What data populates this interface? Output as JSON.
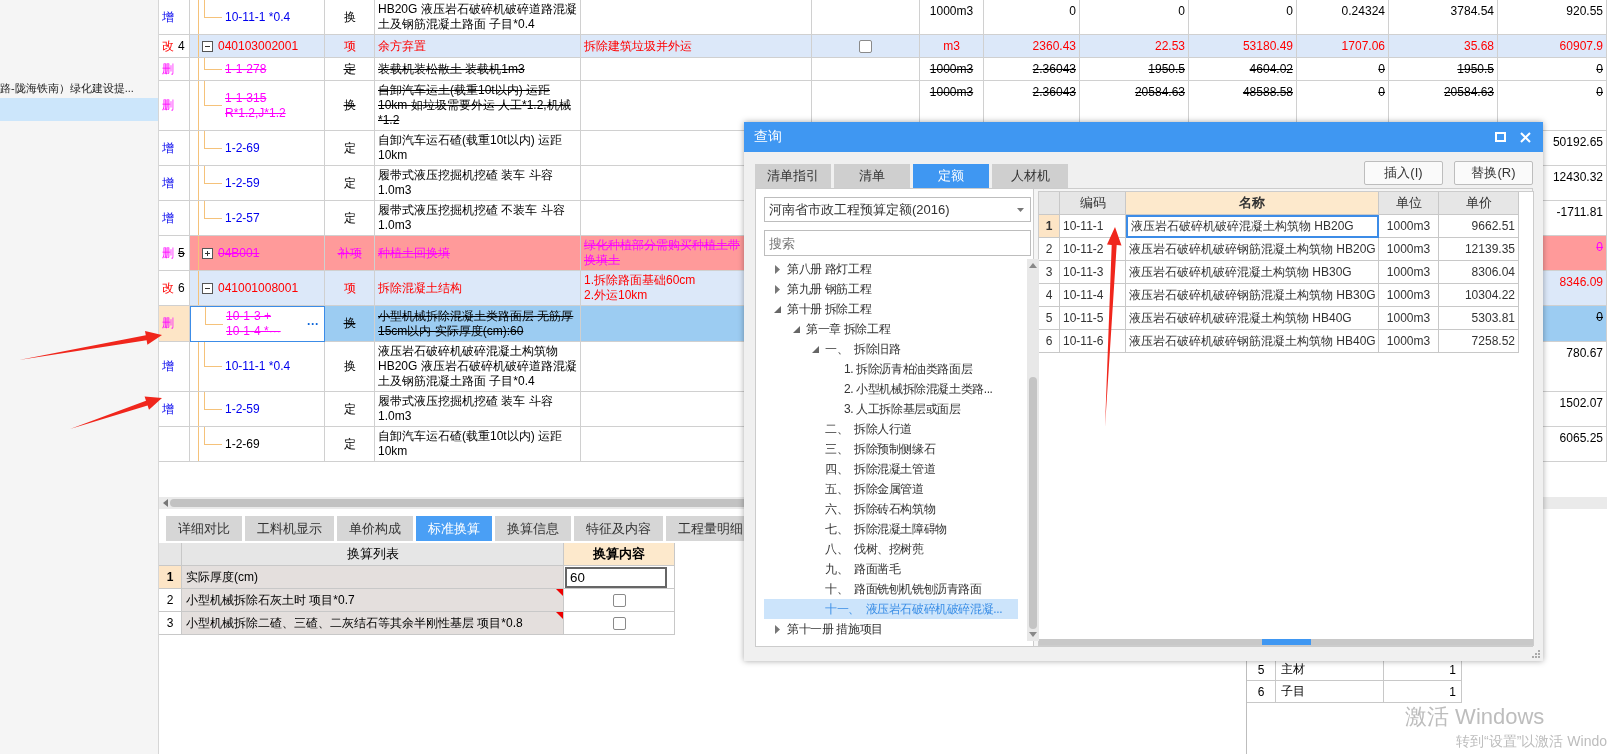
{
  "sidebar": {
    "label": "路-陇海铁南）绿化建设提..."
  },
  "main_grid": {
    "rows": [
      {
        "mark": {
          "label": "增",
          "kind": "added"
        },
        "kind": "sub",
        "code": "10-11-1 *0.4",
        "type": "换",
        "name": "HB20G  液压岩石破碎机破碎道路混凝土及钢筋混凝土路面 子目*0.4",
        "unit": "1000m3",
        "values": [
          "0",
          "0",
          "0",
          "0.24324",
          "3784.54",
          "920.55"
        ],
        "selected": false
      },
      {
        "mark": {
          "label": "改",
          "kind": "modified"
        },
        "number": "4",
        "kind": "item",
        "expanded": true,
        "code": "040103002001",
        "type": "项",
        "name": "余方弃置",
        "feature": "拆除建筑垃圾并外运",
        "checked": false,
        "unit": "m3",
        "values": [
          "2360.43",
          "22.53",
          "53180.49",
          "1707.06",
          "35.68",
          "60907.9"
        ],
        "selected": false
      },
      {
        "mark": {
          "label": "删",
          "kind": "deleted"
        },
        "kind": "sub",
        "code": "1-1-278",
        "type": "定",
        "name": "装载机装松散土 装载机1m3",
        "unit": "1000m3",
        "values": [
          "2.36043",
          "1950.5",
          "4604.02",
          "0",
          "1950.5",
          "0"
        ],
        "selected": false
      },
      {
        "mark": {
          "label": "删",
          "kind": "deleted"
        },
        "kind": "sub",
        "code": "1-1-315\nR*1.2,J*1.2",
        "type": "换",
        "name": "自卸汽车运土(载重10t以内) 运距10km  如垃圾需要外运 人工*1.2,机械*1.2",
        "unit": "1000m3",
        "values": [
          "2.36043",
          "20584.63",
          "48588.58",
          "0",
          "20584.63",
          "0"
        ],
        "selected": false
      },
      {
        "mark": {
          "label": "增",
          "kind": "added"
        },
        "kind": "sub",
        "code": "1-2-69",
        "type": "定",
        "name": "自卸汽车运石碴(载重10t以内) 运距10km",
        "values": [
          "50192.65"
        ],
        "selected": false
      },
      {
        "mark": {
          "label": "增",
          "kind": "added"
        },
        "kind": "sub",
        "code": "1-2-59",
        "type": "定",
        "name": "履带式液压挖掘机挖碴 装车 斗容1.0m3",
        "values": [
          "12430.32"
        ],
        "selected": false
      },
      {
        "mark": {
          "label": "增",
          "kind": "added"
        },
        "kind": "sub",
        "code": "1-2-57",
        "type": "定",
        "name": "履带式液压挖掘机挖碴 不装车 斗容1.0m3",
        "values": [
          "-1711.81"
        ],
        "selected": false
      },
      {
        "mark": {
          "label": "删",
          "kind": "deleted"
        },
        "number": "5",
        "kind": "item",
        "expanded": false,
        "code": "04B001",
        "type": "补项",
        "name": "种植土回换填",
        "feature": "绿化种植部分需购买种植土带换填土",
        "values": [
          "0"
        ],
        "selected": false
      },
      {
        "mark": {
          "label": "改",
          "kind": "modified"
        },
        "number": "6",
        "kind": "item",
        "expanded": true,
        "code": "041001008001",
        "type": "项",
        "name": "拆除混凝土结构",
        "feature": "1.拆除路面基础60cm\n2.外运10km",
        "values": [
          "8346.09"
        ],
        "selected": false
      },
      {
        "mark": {
          "label": "删",
          "kind": "deleted"
        },
        "kind": "sub",
        "code": "10-1-3 +\n10-1-4 *···",
        "more": "···",
        "type": "换",
        "name": "小型机械拆除混凝土类路面层 无筋厚15cm以内  实际厚度(cm):60",
        "values": [
          "0"
        ],
        "selected": true
      },
      {
        "mark": {
          "label": "增",
          "kind": "added"
        },
        "kind": "sub",
        "code": "10-11-1 *0.4",
        "type": "换",
        "name": "液压岩石破碎机破碎混凝土构筑物HB20G  液压岩石破碎机破碎道路混凝土及钢筋混凝土路面 子目*0.4",
        "values": [
          "780.67"
        ],
        "selected": false
      },
      {
        "mark": {
          "label": "增",
          "kind": "added"
        },
        "kind": "sub",
        "code": "1-2-59",
        "type": "定",
        "name": "履带式液压挖掘机挖碴 装车 斗容1.0m3",
        "values": [
          "1502.07"
        ],
        "selected": false
      },
      {
        "kind": "sub",
        "code": "1-2-69",
        "type": "定",
        "name": "自卸汽车运石碴(载重10t以内) 运距10km",
        "values": [
          "6065.25"
        ],
        "selected": false
      }
    ]
  },
  "detail_tabs": [
    {
      "label": "详细对比",
      "selected": false
    },
    {
      "label": "工料机显示",
      "selected": false
    },
    {
      "label": "单价构成",
      "selected": false
    },
    {
      "label": "标准换算",
      "selected": true
    },
    {
      "label": "换算信息",
      "selected": false
    },
    {
      "label": "特征及内容",
      "selected": false
    },
    {
      "label": "工程量明细",
      "selected": false
    }
  ],
  "conversion_table": {
    "columns": [
      "换算列表",
      "换算内容"
    ],
    "rows": [
      {
        "number": "1",
        "label": "实际厚度(cm)",
        "kind": "input",
        "value": "60",
        "selected": true,
        "marked": false
      },
      {
        "number": "2",
        "label": "小型机械拆除石灰土时 项目*0.7",
        "kind": "checkbox",
        "checked": false,
        "selected": false,
        "marked": true
      },
      {
        "number": "3",
        "label": "小型机械拆除二碴、三碴、二灰结石等其余半刚性基层 项目*0.8",
        "kind": "checkbox",
        "checked": false,
        "selected": false,
        "marked": true
      }
    ]
  },
  "side_table": {
    "rows": [
      {
        "number": "5",
        "name": "主材",
        "value": "1"
      },
      {
        "number": "6",
        "name": "子目",
        "value": "1"
      }
    ]
  },
  "query_dialog": {
    "title": "查询",
    "tabs": [
      {
        "label": "清单指引",
        "selected": false
      },
      {
        "label": "清单",
        "selected": false
      },
      {
        "label": "定额",
        "selected": true
      },
      {
        "label": "人材机",
        "selected": false
      }
    ],
    "buttons": [
      "插入(I)",
      "替换(R)"
    ],
    "library": "河南省市政工程预算定额(2016)",
    "search": {
      "placeholder": "搜索"
    },
    "tree": [
      {
        "label": "第八册 路灯工程",
        "expanded": false,
        "selected": false
      },
      {
        "label": "第九册 钢筋工程",
        "expanded": false,
        "selected": false
      },
      {
        "label": "第十册 拆除工程",
        "expanded": true,
        "selected": false,
        "children": [
          {
            "label": "第一章 拆除工程",
            "expanded": true,
            "selected": false,
            "children": [
              {
                "label": "一、  拆除旧路",
                "expanded": true,
                "selected": false,
                "children": [
                  {
                    "label": "1. 拆除沥青柏油类路面层",
                    "selected": false
                  },
                  {
                    "label": "2. 小型机械拆除混凝土类路...",
                    "selected": false
                  },
                  {
                    "label": "3. 人工拆除基层或面层",
                    "selected": false
                  }
                ]
              },
              {
                "label": "二、  拆除人行道",
                "selected": false
              },
              {
                "label": "三、  拆除预制侧缘石",
                "selected": false
              },
              {
                "label": "四、  拆除混凝土管道",
                "selected": false
              },
              {
                "label": "五、  拆除金属管道",
                "selected": false
              },
              {
                "label": "六、  拆除砖石构筑物",
                "selected": false
              },
              {
                "label": "七、  拆除混凝土障碍物",
                "selected": false
              },
              {
                "label": "八、  伐树、挖树蔸",
                "selected": false
              },
              {
                "label": "九、  路面凿毛",
                "selected": false
              },
              {
                "label": "十、  路面铣刨机铣刨沥青路面",
                "selected": false
              },
              {
                "label": "十一、  液压岩石破碎机破碎混凝...",
                "selected": true
              }
            ]
          }
        ]
      },
      {
        "label": "第十一册 措施项目",
        "expanded": false,
        "selected": false
      }
    ],
    "results": {
      "columns": [
        "编码",
        "名称",
        "单位",
        "单价"
      ],
      "rows": [
        {
          "number": "1",
          "code": "10-11-1",
          "name": "液压岩石破碎机破碎混凝土构筑物 HB20G",
          "unit": "1000m3",
          "price": "9662.51",
          "selected": true
        },
        {
          "number": "2",
          "code": "10-11-2",
          "name": "液压岩石破碎机破碎钢筋混凝土构筑物 HB20G",
          "unit": "1000m3",
          "price": "12139.35",
          "selected": false
        },
        {
          "number": "3",
          "code": "10-11-3",
          "name": "液压岩石破碎机破碎混凝土构筑物 HB30G",
          "unit": "1000m3",
          "price": "8306.04",
          "selected": false
        },
        {
          "number": "4",
          "code": "10-11-4",
          "name": "液压岩石破碎机破碎钢筋混凝土构筑物 HB30G",
          "unit": "1000m3",
          "price": "10304.22",
          "selected": false
        },
        {
          "number": "5",
          "code": "10-11-5",
          "name": "液压岩石破碎机破碎混凝土构筑物 HB40G",
          "unit": "1000m3",
          "price": "5303.81",
          "selected": false
        },
        {
          "number": "6",
          "code": "10-11-6",
          "name": "液压岩石破碎机破碎钢筋混凝土构筑物 HB40G",
          "unit": "1000m3",
          "price": "7258.52",
          "selected": false
        }
      ]
    }
  },
  "activation_notice": {
    "title": "激活 Windows",
    "hint": "转到“设置”以激活 Windo"
  }
}
